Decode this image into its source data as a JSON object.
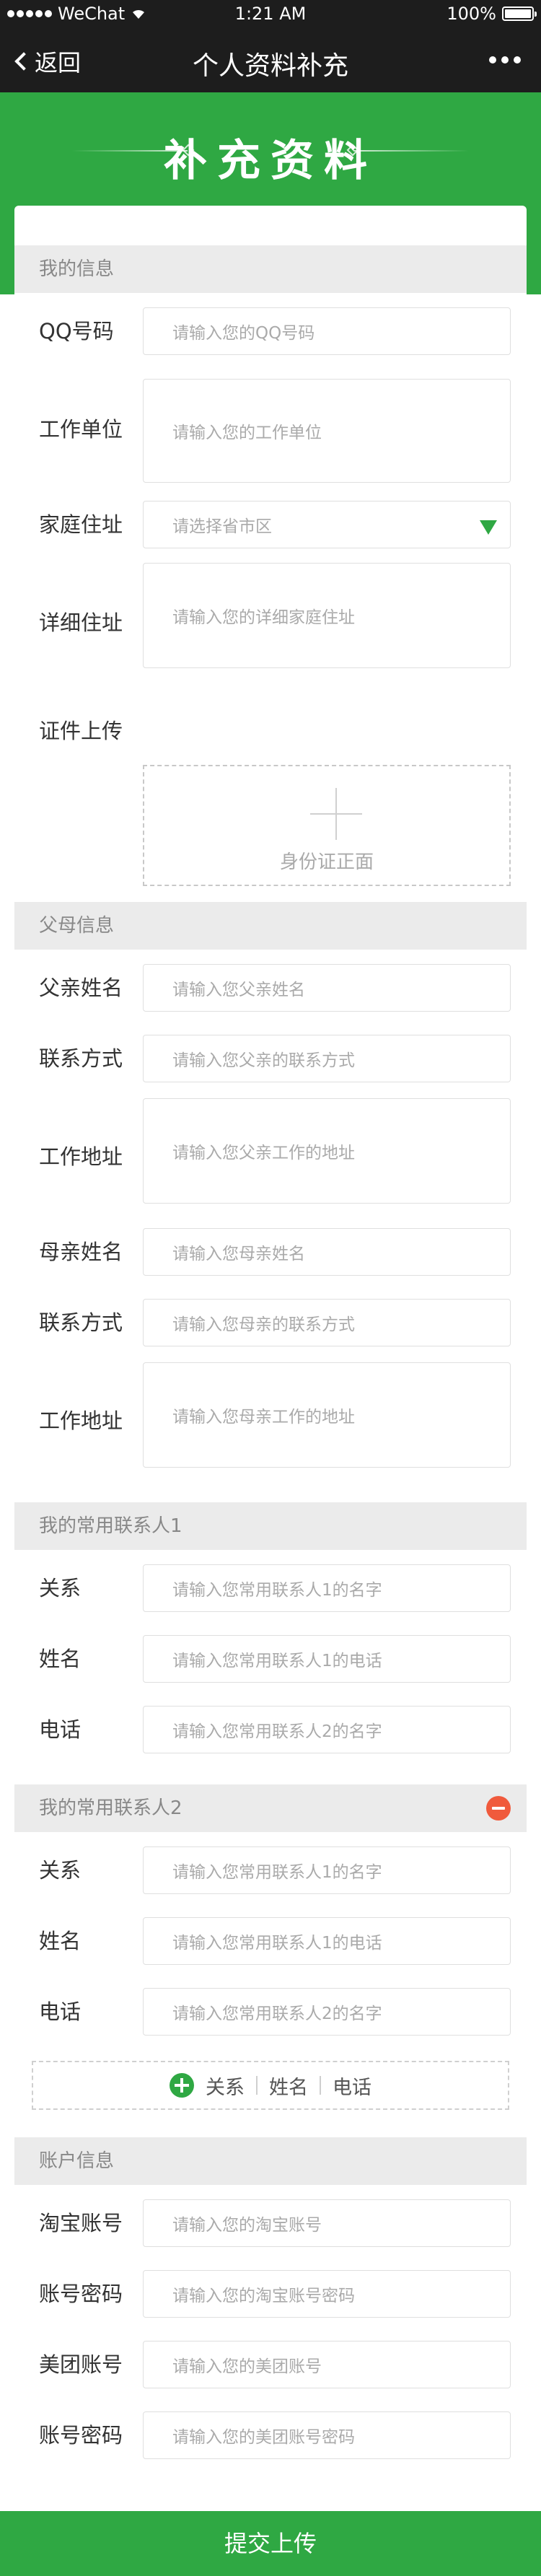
{
  "status_bar": {
    "carrier": "WeChat",
    "time": "1:21 AM",
    "battery": "100%"
  },
  "nav": {
    "back_label": "返回",
    "title": "个人资料补充"
  },
  "hero": {
    "title": "补充资料"
  },
  "sections": {
    "my_info": "我的信息",
    "parents": "父母信息",
    "contact1": "我的常用联系人1",
    "contact2": "我的常用联系人2",
    "account": "账户信息"
  },
  "my_info": {
    "qq_label": "QQ号码",
    "qq_placeholder": "请输入您的QQ号码",
    "work_label": "工作单位",
    "work_placeholder": "请输入您的工作单位",
    "home_label": "家庭住址",
    "home_placeholder": "请选择省市区",
    "detail_label": "详细住址",
    "detail_placeholder": "请输入您的详细家庭住址",
    "id_label": "证件上传",
    "id_upload_text": "身份证正面"
  },
  "parents": {
    "father_name_label": "父亲姓名",
    "father_name_placeholder": "请输入您父亲姓名",
    "father_contact_label": "联系方式",
    "father_contact_placeholder": "请输入您父亲的联系方式",
    "father_work_label": "工作地址",
    "father_work_placeholder": "请输入您父亲工作的地址",
    "mother_name_label": "母亲姓名",
    "mother_name_placeholder": "请输入您母亲姓名",
    "mother_contact_label": "联系方式",
    "mother_contact_placeholder": "请输入您母亲的联系方式",
    "mother_work_label": "工作地址",
    "mother_work_placeholder": "请输入您母亲工作的地址"
  },
  "contact1": {
    "relation_label": "关系",
    "relation_placeholder": "请输入您常用联系人1的名字",
    "name_label": "姓名",
    "name_placeholder": "请输入您常用联系人1的电话",
    "phone_label": "电话",
    "phone_placeholder": "请输入您常用联系人2的名字"
  },
  "contact2": {
    "relation_label": "关系",
    "relation_placeholder": "请输入您常用联系人1的名字",
    "name_label": "姓名",
    "name_placeholder": "请输入您常用联系人1的电话",
    "phone_label": "电话",
    "phone_placeholder": "请输入您常用联系人2的名字"
  },
  "add_contact": {
    "relation": "关系",
    "name": "姓名",
    "phone": "电话"
  },
  "account": {
    "taobao_label": "淘宝账号",
    "taobao_placeholder": "请输入您的淘宝账号",
    "taobao_pwd_label": "账号密码",
    "taobao_pwd_placeholder": "请输入您的淘宝账号密码",
    "meituan_label": "美团账号",
    "meituan_placeholder": "请输入您的美团账号",
    "meituan_pwd_label": "账号密码",
    "meituan_pwd_placeholder": "请输入您的美团账号密码"
  },
  "submit_label": "提交上传",
  "colors": {
    "accent": "#2fa843",
    "danger": "#f05a3c",
    "bar": "#1d1d1d"
  }
}
